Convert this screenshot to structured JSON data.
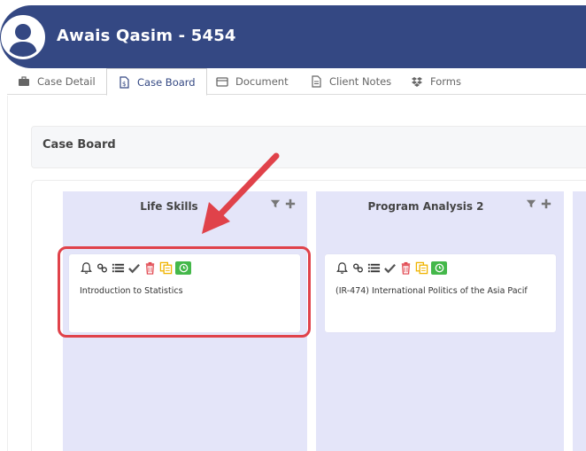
{
  "header": {
    "title": "Awais Qasim - 5454"
  },
  "tabs": [
    {
      "label": "Case Detail",
      "icon": "briefcase-icon"
    },
    {
      "label": "Case Board",
      "icon": "document-dollar-icon",
      "active": true
    },
    {
      "label": "Document",
      "icon": "folder-icon"
    },
    {
      "label": "Client Notes",
      "icon": "note-icon"
    },
    {
      "label": "Forms",
      "icon": "dropbox-icon"
    }
  ],
  "section": {
    "title": "Case Board"
  },
  "columns": [
    {
      "title": "Life Skills",
      "cards": [
        {
          "text": "Introduction to Statistics"
        }
      ]
    },
    {
      "title": "Program Analysis 2",
      "cards": [
        {
          "text": "(IR-474) International Politics of the Asia Pacif"
        }
      ]
    }
  ],
  "colors": {
    "header": "#344883",
    "column": "#e4e5f9",
    "highlight": "#e0424a",
    "trash": "#e0424a",
    "copy": "#f0b400",
    "clock": "#44b84a"
  }
}
